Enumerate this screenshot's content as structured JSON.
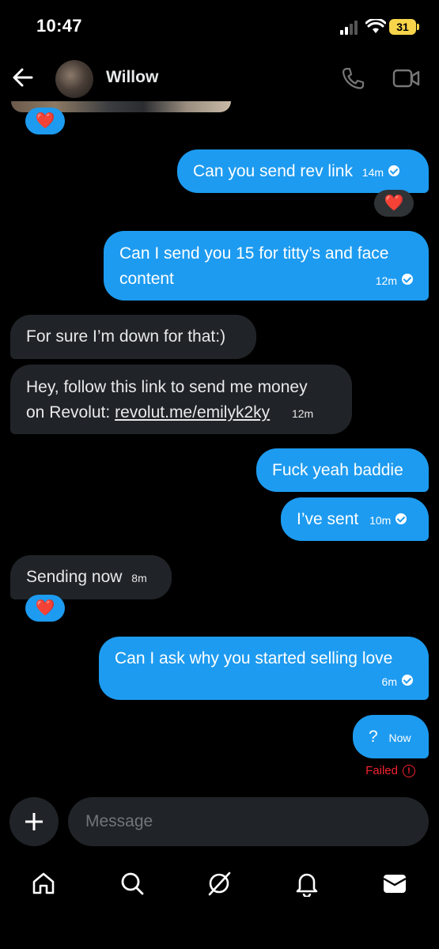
{
  "status_bar": {
    "time": "10:47",
    "battery": "31"
  },
  "header": {
    "contact_name": "Willow"
  },
  "messages": [
    {
      "dir": "out",
      "text": "Can you send rev link",
      "time": "14m",
      "delivered": true,
      "reaction": "❤️"
    },
    {
      "dir": "out",
      "lines": [
        "Can I send you 15 for titty’s and face",
        "content"
      ],
      "time": "12m",
      "delivered": true
    },
    {
      "dir": "in",
      "text": "For sure I’m down for that:)"
    },
    {
      "dir": "in",
      "line1": "Hey, follow this link to send me money",
      "line2_prefix": "on Revolut: ",
      "link": "revolut.me/emilyk2ky",
      "time": "12m"
    },
    {
      "dir": "out",
      "text": "Fuck yeah baddie"
    },
    {
      "dir": "out",
      "text": "I’ve sent",
      "time": "10m",
      "delivered": true
    },
    {
      "dir": "in",
      "text": "Sending now",
      "time": "8m",
      "reaction": "❤️"
    },
    {
      "dir": "out",
      "text": "Can I ask why you started selling love",
      "time": "6m",
      "delivered": true
    },
    {
      "dir": "out",
      "text": "?",
      "time": "Now",
      "status": "Failed"
    }
  ],
  "top_reaction": "❤️",
  "composer": {
    "placeholder": "Message"
  },
  "colors": {
    "accent": "#1d9bf0",
    "incoming": "#202327",
    "error": "#f4212e",
    "background": "#000000"
  },
  "nav": [
    "home-icon",
    "search-icon",
    "grok-icon",
    "notifications-icon",
    "messages-icon"
  ]
}
